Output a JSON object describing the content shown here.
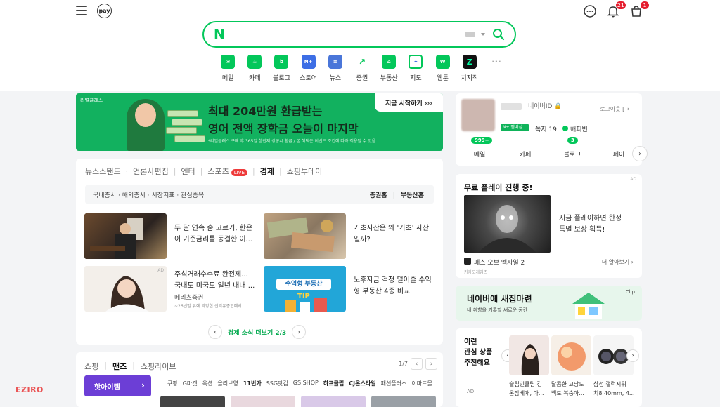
{
  "top": {
    "pay_label": "pay",
    "notification_count": "21",
    "cart_count": "1"
  },
  "search": {
    "logo": "N",
    "placeholder": ""
  },
  "shortcuts": [
    {
      "label": "메일",
      "icon": "mail-icon",
      "color": "#03c75a"
    },
    {
      "label": "카페",
      "icon": "cafe-icon",
      "color": "#03c75a"
    },
    {
      "label": "블로그",
      "icon": "blog-icon",
      "color": "#03c75a"
    },
    {
      "label": "스토어",
      "icon": "store-icon",
      "color": "#3d6ee5"
    },
    {
      "label": "뉴스",
      "icon": "news-icon",
      "color": "#4a76d9"
    },
    {
      "label": "증권",
      "icon": "stock-icon",
      "color": "#03c75a"
    },
    {
      "label": "부동산",
      "icon": "realestate-icon",
      "color": "#03c75a"
    },
    {
      "label": "지도",
      "icon": "map-icon",
      "color": "#03c75a"
    },
    {
      "label": "웹툰",
      "icon": "webtoon-icon",
      "color": "#03c75a"
    },
    {
      "label": "치지직",
      "icon": "chzzk-icon",
      "color": "#111111"
    }
  ],
  "banner": {
    "tag": "리얼클래스",
    "title1": "최대 204만원 환급받는",
    "title2": "영어 전액 장학금 오늘이 마지막",
    "note": "*리얼클래스 구매 후 365일 챌린지 성공시 환급 / 본 혜택은 이벤트 조건에 따라 적용될 수 있음",
    "cta": "지금 시작하기 ›››"
  },
  "news": {
    "tabs": [
      "뉴스스탠드",
      "언론사편집",
      "엔터",
      "스포츠",
      "경제",
      "쇼핑투데이"
    ],
    "live_label": "LIVE",
    "subtabs_left": "국내증시 · 해외증시 · 시장지표 · 관심종목",
    "subtabs_right1": "증권홈",
    "subtabs_right2": "부동산홈",
    "items": [
      {
        "title": "두 달 연속 숨 고르기, 한은이 기준금리를 동결한 이..."
      },
      {
        "title": "기초자산은 왜 '기초' 자산일까?"
      },
      {
        "title": "주식거래수수료 완전제... 국내도 미국도 일년 내내 ...",
        "sub": "메리츠증권",
        "tiny": "~26년말 유예 막망한 신리유증권에서"
      },
      {
        "title": "노후자금 걱정 덜어줄 수익형 부동산 4종 비교"
      }
    ],
    "ad_label": "AD",
    "thumb_text": "수익형 부동산",
    "thumb_tip": "TIP",
    "pager_text": "경제 소식 더보기 2/3"
  },
  "shop": {
    "tabs": [
      "쇼핑",
      "맨즈",
      "쇼핑라이브"
    ],
    "page": "1/7",
    "hot_label": "핫아이템",
    "links": [
      "쿠팡",
      "G마켓",
      "옥션",
      "올리브영",
      "11번가",
      "SSG닷컴",
      "GS SHOP",
      "하프클럽",
      "CJ온스타일",
      "패션플러스",
      "이마트몰"
    ]
  },
  "profile": {
    "naverid": "네이버ID 🔒",
    "logout": "로그아웃 [→",
    "npay_tag": "N+ 멤버십",
    "stat1": "쪽지 19",
    "stat2": "해피빈",
    "tabs": [
      "메일",
      "카페",
      "블로그",
      "페이"
    ],
    "mail_badge": "999+",
    "blog_badge": "3"
  },
  "ad1": {
    "heading": "무료 플레이 진행 중!",
    "corner": "AD",
    "text1": "지금 플레이하면 한정",
    "text2": "특별 보상 획득!",
    "game": "패스 오브 엑자일 2",
    "more": "더 알아보기 ›",
    "tiny": "카카오게임즈"
  },
  "ad2": {
    "title": "네이버에 새집마련",
    "sub": "내 취향을 기록할 새로운 공간",
    "clip": "Clip"
  },
  "ad3": {
    "title1": "이런",
    "title2": "관심 상품",
    "title3": "추천해요",
    "ad": "AD",
    "products": [
      {
        "line1": "슬립인클립 김",
        "line2": "온잠베개, 아..."
      },
      {
        "line1": "달콤한 고당도",
        "line2": "백도 복숭아..."
      },
      {
        "line1": "삼성 갤럭시워",
        "line2": "치8 40mm, 4..."
      }
    ]
  },
  "watermark": "EZIRO",
  "colors": {
    "naver_green": "#03c75a",
    "banner_green": "#12b15f",
    "shop_purple": "#6c3ed6"
  }
}
